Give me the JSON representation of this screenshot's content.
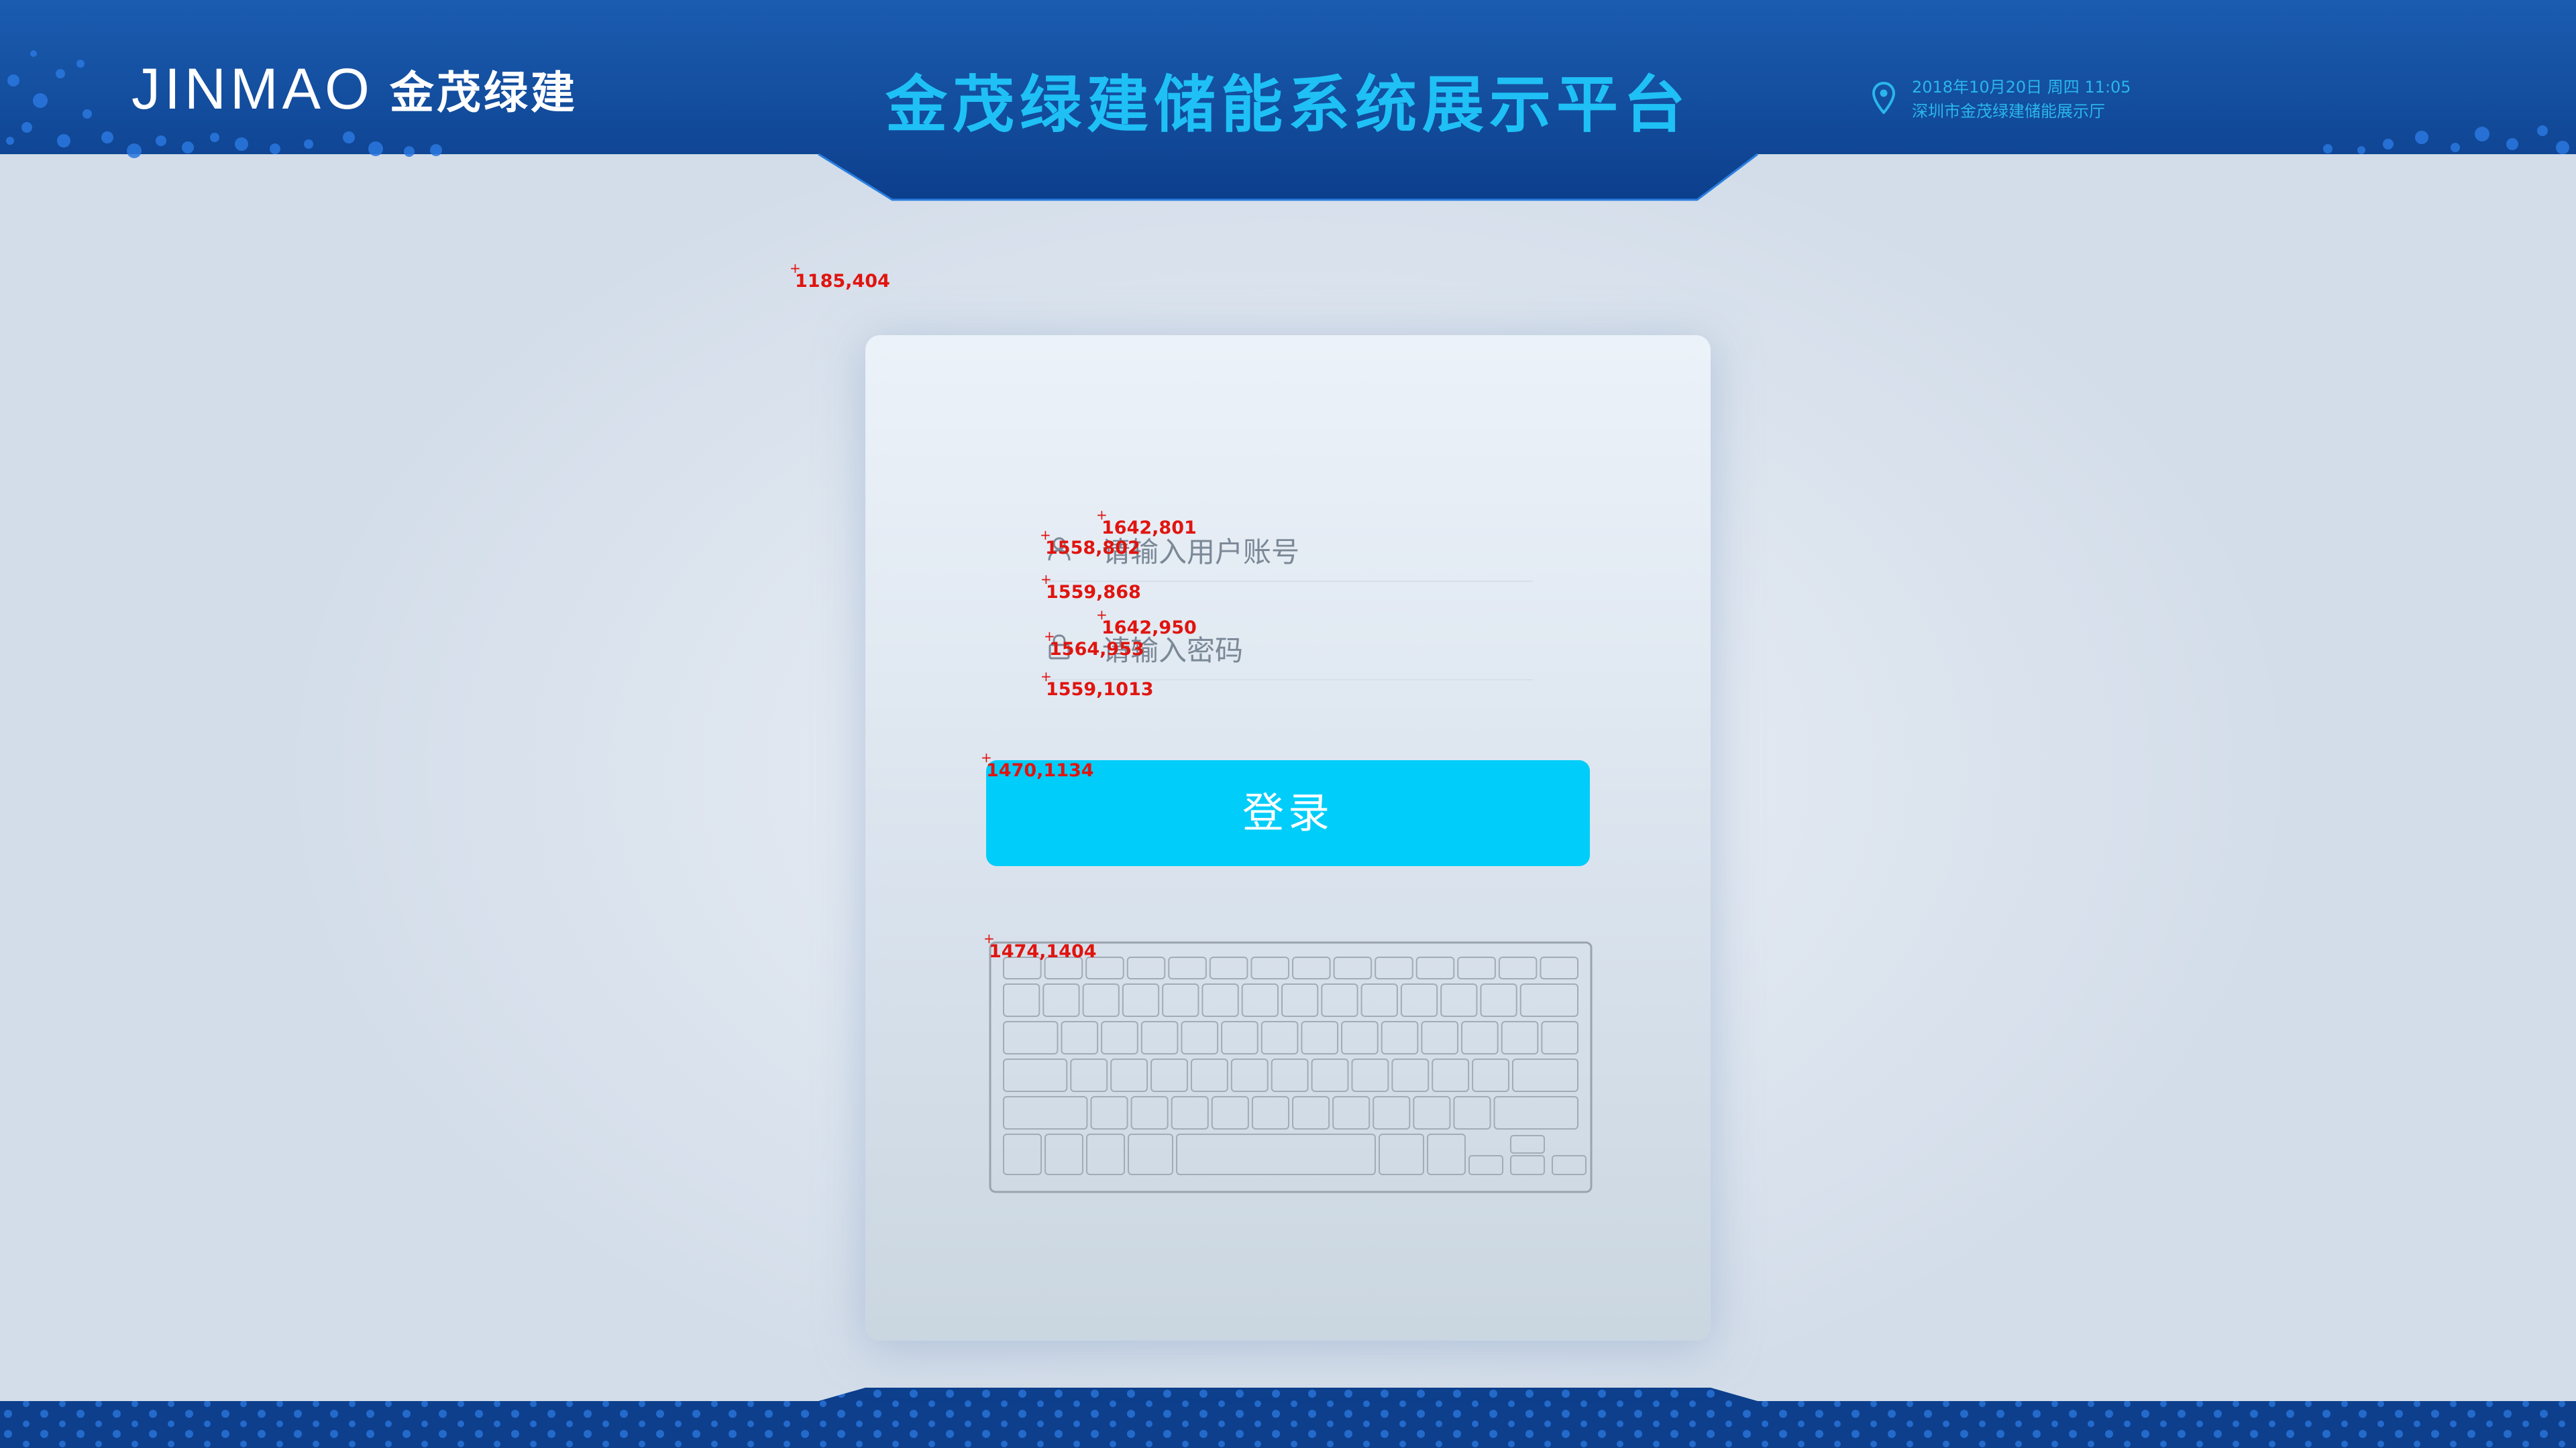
{
  "header": {
    "logo_en": "JINMAO",
    "logo_cn": "金茂绿建",
    "title": "金茂绿建储能系统展示平台",
    "datetime": "2018年10月20日 周四 11:05",
    "location": "深圳市金茂绿建储能展示厅",
    "location_icon": "map-pin-icon"
  },
  "login": {
    "username_placeholder": "请输入用户账号",
    "password_placeholder": "请输入密码",
    "username_icon": "user-icon",
    "password_icon": "lock-icon",
    "button_label": "登录",
    "keyboard": "on-screen-keyboard"
  },
  "annotations": [
    "1185,404",
    "1642,801",
    "1558,802",
    "1559,868",
    "1642,950",
    "1564,953",
    "1559,1013",
    "1470,1134",
    "1474,1404"
  ],
  "colors": {
    "header_blue": "#0e4a9a",
    "title_cyan": "#1fc0f5",
    "button_cyan": "#00cdfa",
    "annotation_red": "#e0140f"
  }
}
